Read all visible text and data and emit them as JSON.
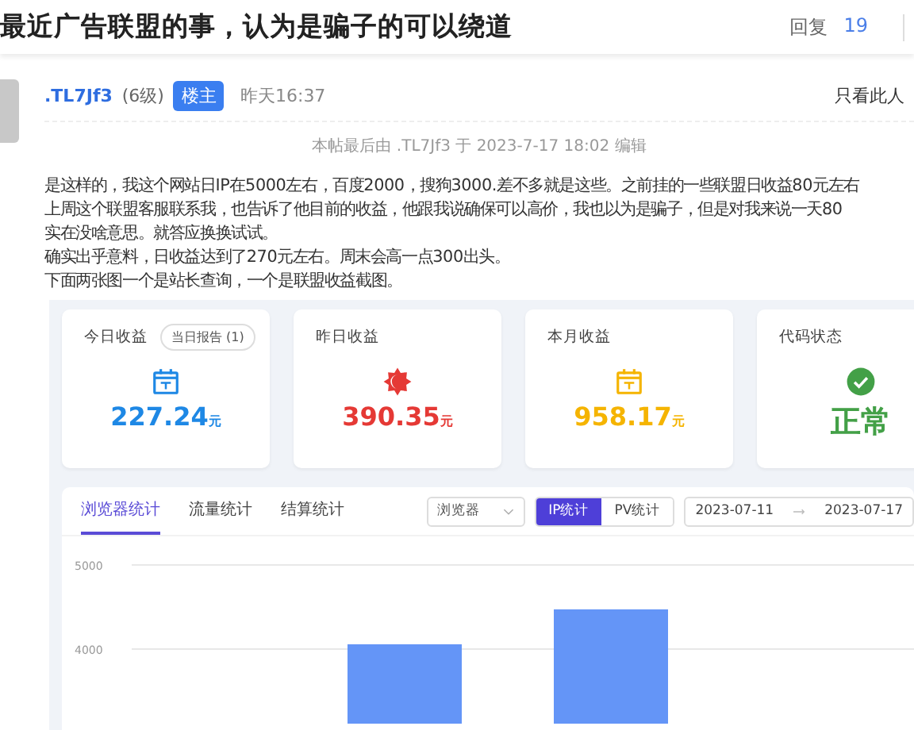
{
  "topic": {
    "title": "最近广告联盟的事，认为是骗子的可以绕道",
    "reply_label": "回复",
    "reply_count": "19"
  },
  "post": {
    "author": ".TL7Jf3",
    "level": "(6级)",
    "badge": "楼主",
    "time": "昨天16:37",
    "only_author": "只看此人",
    "edit_note": "本帖最后由 .TL7Jf3 于 2023-7-17 18:02 编辑",
    "body": [
      "是这样的，我这个网站日IP在5000左右，百度2000，搜狗3000.差不多就是这些。之前挂的一些联盟日收益80元左右",
      "上周这个联盟客服联系我，也告诉了他目前的收益，他跟我说确保可以高价，我也以为是骗子，但是对我来说一天80",
      "实在没啥意思。就答应换换试试。",
      "确实出乎意料，日收益达到了270元左右。周末会高一点300出头。",
      "下面两张图一个是站长查询，一个是联盟收益截图。"
    ]
  },
  "screenshot": {
    "cards": [
      {
        "kind": "today",
        "title": "今日收益",
        "button": "当日报告 (1)",
        "value": "227.24",
        "unit": "元",
        "color": "#1e88e5"
      },
      {
        "kind": "yesterday",
        "title": "昨日收益",
        "value": "390.35",
        "unit": "元",
        "color": "#e53935"
      },
      {
        "kind": "month",
        "title": "本月收益",
        "value": "958.17",
        "unit": "元",
        "color": "#f5b400"
      },
      {
        "kind": "status",
        "title": "代码状态",
        "value": "正常",
        "color": "#43a047"
      }
    ],
    "tabs": [
      {
        "label": "浏览器统计",
        "selected": true
      },
      {
        "label": "流量统计",
        "selected": false
      },
      {
        "label": "结算统计",
        "selected": false
      }
    ],
    "select": {
      "value": "浏览器"
    },
    "toggle": [
      {
        "label": "IP统计",
        "selected": true
      },
      {
        "label": "PV统计",
        "selected": false
      }
    ],
    "date_range": {
      "start": "2023-07-11",
      "end": "2023-07-17"
    },
    "chart_axis_labels": [
      "5000",
      "4000"
    ]
  }
}
